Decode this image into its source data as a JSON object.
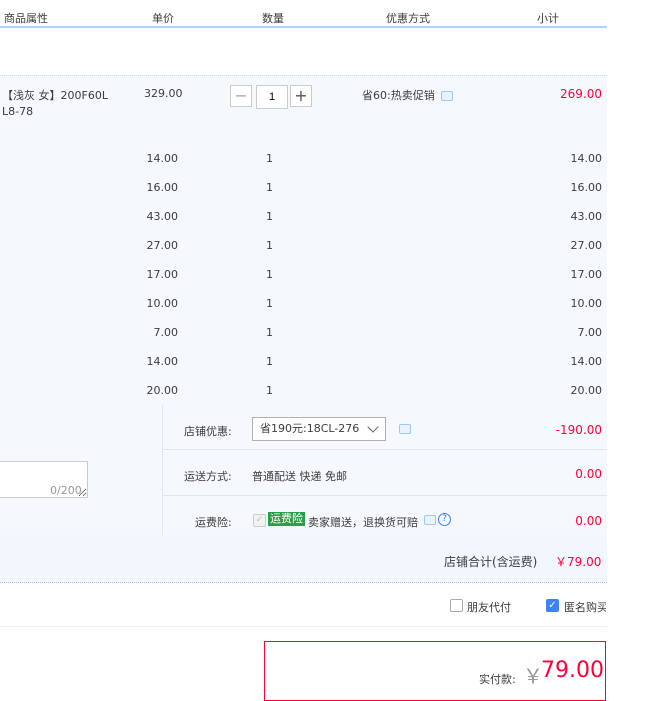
{
  "header": {
    "col_attr": "商品属性",
    "col_price": "单价",
    "col_qty": "数量",
    "col_promo": "优惠方式",
    "col_subtotal": "小计"
  },
  "main_item": {
    "attr_line1": "【浅灰 女】200F60L",
    "attr_line2": "L8-78",
    "price": "329.00",
    "qty": "1",
    "minus": "−",
    "plus": "+",
    "promo": "省60:热卖促销",
    "subtotal": "269.00"
  },
  "rows": [
    {
      "price": "14.00",
      "qty": "1",
      "subtotal": "14.00"
    },
    {
      "price": "16.00",
      "qty": "1",
      "subtotal": "16.00"
    },
    {
      "price": "43.00",
      "qty": "1",
      "subtotal": "43.00"
    },
    {
      "price": "27.00",
      "qty": "1",
      "subtotal": "27.00"
    },
    {
      "price": "17.00",
      "qty": "1",
      "subtotal": "17.00"
    },
    {
      "price": "10.00",
      "qty": "1",
      "subtotal": "10.00"
    },
    {
      "price": "7.00",
      "qty": "1",
      "subtotal": "7.00"
    },
    {
      "price": "14.00",
      "qty": "1",
      "subtotal": "14.00"
    },
    {
      "price": "20.00",
      "qty": "1",
      "subtotal": "20.00"
    }
  ],
  "shop": {
    "discount_label": "店铺优惠:",
    "discount_select": "省190元:18CL-276",
    "discount_amount": "-190.00",
    "shipping_label": "运送方式:",
    "shipping_value": "普通配送 快递 免邮",
    "shipping_amount": "0.00",
    "insurance_label": "运费险:",
    "insurance_tag": "运费险",
    "insurance_text": "卖家赠送，退换货可赔",
    "insurance_amount": "0.00",
    "message_count": "0/200",
    "total_label": "店铺合计(含运费)",
    "total_value": "￥79.00"
  },
  "options": {
    "friend_pay": "朋友代付",
    "anonymous": "匿名购买",
    "friend_checked": false,
    "anonymous_checked": true
  },
  "payment": {
    "label": "实付款:",
    "currency": "￥",
    "amount": "79.00"
  },
  "colors": {
    "accent_red": "#ff0036",
    "band": "#f5f8fd",
    "checkbox_blue": "#3d82f7",
    "insurance_green": "#2a9f4a"
  }
}
